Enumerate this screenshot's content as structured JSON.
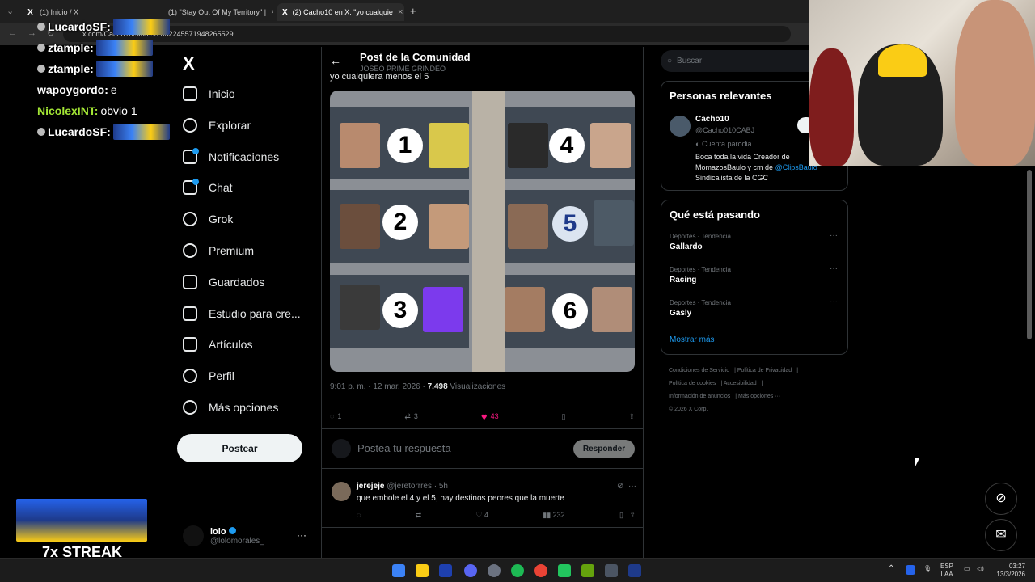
{
  "browser": {
    "tabs": [
      {
        "title": "(1) Inicio / X",
        "active": false
      },
      {
        "title": "(1) \"Stay Out Of My Territory\" |",
        "active": false
      },
      {
        "title": "(2) Cacho10 en X: \"yo cualquie",
        "active": true
      }
    ],
    "new_tab": "+",
    "url": "x.com/Cacho10/status/2032245571948265529"
  },
  "chat_overlay": {
    "messages": [
      {
        "user": "LucardoSF:",
        "text": "",
        "user_color": "#ffffff"
      },
      {
        "user": "ztample:",
        "text": "",
        "user_color": "#ffffff"
      },
      {
        "user": "ztample:",
        "text": "",
        "user_color": "#ffffff"
      },
      {
        "user": "wapoygordo:",
        "text": "e",
        "user_color": "#ffffff"
      },
      {
        "user": "NicolexINT:",
        "text": "obvio 1",
        "user_color": "#a3e635"
      },
      {
        "user": "LucardoSF:",
        "text": "",
        "user_color": "#ffffff"
      }
    ],
    "streak": "7x STREAK"
  },
  "nav": {
    "logo": "X",
    "items": [
      {
        "label": "Inicio",
        "icon": "home-icon"
      },
      {
        "label": "Explorar",
        "icon": "search-icon"
      },
      {
        "label": "Notificaciones",
        "icon": "bell-icon"
      },
      {
        "label": "Chat",
        "icon": "mail-icon"
      },
      {
        "label": "Grok",
        "icon": "grok-icon"
      },
      {
        "label": "Premium",
        "icon": "verified-icon"
      },
      {
        "label": "Guardados",
        "icon": "bookmark-icon"
      },
      {
        "label": "Estudio para cre...",
        "icon": "rocket-icon"
      },
      {
        "label": "Artículos",
        "icon": "article-icon"
      },
      {
        "label": "Perfil",
        "icon": "person-icon"
      },
      {
        "label": "Más opciones",
        "icon": "more-circle-icon"
      }
    ],
    "post_button": "Postear",
    "account": {
      "name": "lolo",
      "handle": "@lolomorales_",
      "more": "···"
    }
  },
  "post": {
    "header_title": "Post de la Comunidad",
    "header_sub": "JOSEO PRIME GRINDEO",
    "text": "yo cualquiera menos el 5",
    "seat_numbers": [
      "1",
      "2",
      "3",
      "4",
      "5",
      "6"
    ],
    "time": "9:01 p. m. · 12 mar. 2026 ·",
    "views_count": "7.498",
    "views_label": "Visualizaciones",
    "replies": "1",
    "reposts": "3",
    "likes": "43",
    "reply_placeholder": "Postea tu respuesta",
    "reply_button": "Responder",
    "comment": {
      "name": "jerejeje",
      "handle": "@jeretorrres · 5h",
      "text": "que embole el 4 y el 5, hay destinos peores que la muerte",
      "likes": "4",
      "views": "232"
    }
  },
  "sidebar": {
    "search_placeholder": "Buscar",
    "relevant_title": "Personas relevantes",
    "person": {
      "name": "Cacho10",
      "handle": "@Cacho010CABJ",
      "parody": "Cuenta parodia",
      "bio_1": "Boca toda la vida Creador de MomazosBaulo y cm de",
      "mention": "@ClipsBaulo",
      "bio_2": "Sindicalista de la CGC"
    },
    "trending_title": "Qué está pasando",
    "trends": [
      {
        "category": "Deportes · Tendencia",
        "name": "Gallardo"
      },
      {
        "category": "Deportes · Tendencia",
        "name": "Racing"
      },
      {
        "category": "Deportes · Tendencia",
        "name": "Gasly"
      }
    ],
    "show_more": "Mostrar más",
    "footer": [
      "Condiciones de Servicio",
      "Política de Privacidad",
      "Política de cookies",
      "Accesibilidad",
      "Información de anuncios",
      "Más opciones ···",
      "© 2026 X Corp."
    ]
  },
  "taskbar": {
    "lang_1": "ESP",
    "lang_2": "LAA",
    "time": "03:27",
    "date": "13/3/2026"
  },
  "colors": {
    "accent": "#1d9bf0",
    "like": "#f91880",
    "bg": "#000000"
  }
}
